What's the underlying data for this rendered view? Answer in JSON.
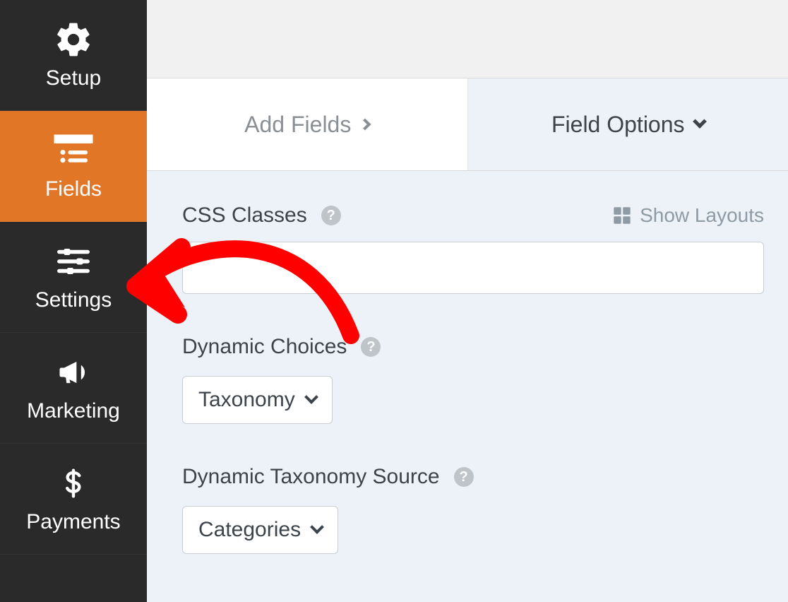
{
  "sidebar": {
    "items": [
      {
        "label": "Setup"
      },
      {
        "label": "Fields"
      },
      {
        "label": "Settings"
      },
      {
        "label": "Marketing"
      },
      {
        "label": "Payments"
      }
    ],
    "active_index": 1
  },
  "tabs": {
    "add_fields": "Add Fields",
    "field_options": "Field Options"
  },
  "panel": {
    "css_classes": {
      "label": "CSS Classes",
      "value": "",
      "show_layouts_label": "Show Layouts"
    },
    "dynamic_choices": {
      "label": "Dynamic Choices",
      "selected": "Taxonomy"
    },
    "dynamic_taxonomy_source": {
      "label": "Dynamic Taxonomy Source",
      "selected": "Categories"
    }
  },
  "annotation": {
    "arrow_points_to": "sidebar-item-settings",
    "color": "#ff0000"
  },
  "colors": {
    "accent": "#e27627",
    "sidebar_bg": "#2a2a2a",
    "panel_bg": "#edf2f8"
  }
}
